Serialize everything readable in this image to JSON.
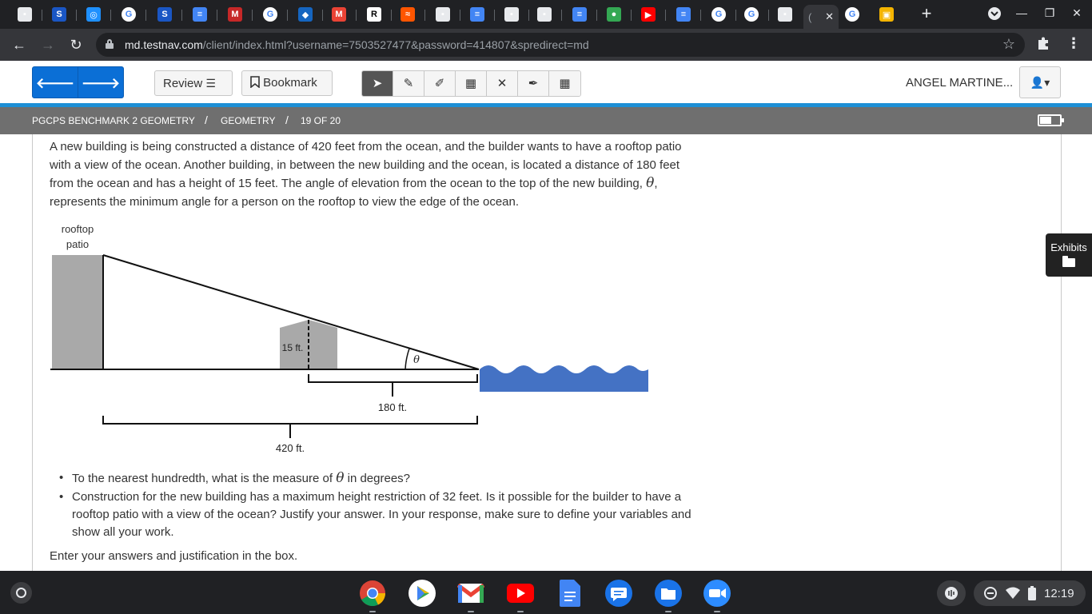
{
  "browser": {
    "url_host": "md.testnav.com",
    "url_path": "/client/index.html?username=7503527477&password=414807&spredirect=md",
    "tabs": [
      {
        "icon": "classroom-icon",
        "color": "#e8eaed",
        "glyph": "▪"
      },
      {
        "icon": "studyisland-icon",
        "color": "#1a56c4",
        "glyph": "S"
      },
      {
        "icon": "edpuzzle-icon",
        "color": "#1e90ff",
        "glyph": "◎"
      },
      {
        "icon": "google-icon",
        "color": "#ffffff",
        "glyph": "G"
      },
      {
        "icon": "studyisland-icon",
        "color": "#1a56c4",
        "glyph": "S"
      },
      {
        "icon": "google-docs-icon",
        "color": "#4285f4",
        "glyph": "≡"
      },
      {
        "icon": "mcgraw-hill-icon",
        "color": "#c62828",
        "glyph": "M"
      },
      {
        "icon": "google-icon",
        "color": "#ffffff",
        "glyph": "G"
      },
      {
        "icon": "clever-icon",
        "color": "#1565c0",
        "glyph": "◆"
      },
      {
        "icon": "gmail-icon",
        "color": "#ea4335",
        "glyph": "M"
      },
      {
        "icon": "readworks-icon",
        "color": "#ffffff",
        "glyph": "R"
      },
      {
        "icon": "soundcloud-icon",
        "color": "#ff5500",
        "glyph": "≈"
      },
      {
        "icon": "classroom-icon",
        "color": "#e8eaed",
        "glyph": "▪"
      },
      {
        "icon": "google-docs-icon",
        "color": "#4285f4",
        "glyph": "≡"
      },
      {
        "icon": "classroom-icon",
        "color": "#e8eaed",
        "glyph": "▪"
      },
      {
        "icon": "classroom-icon",
        "color": "#e8eaed",
        "glyph": "▪"
      },
      {
        "icon": "google-docs-icon",
        "color": "#4285f4",
        "glyph": "≡"
      },
      {
        "icon": "google-maps-icon",
        "color": "#34a853",
        "glyph": "●"
      },
      {
        "icon": "youtube-icon",
        "color": "#ff0000",
        "glyph": "▶"
      },
      {
        "icon": "google-docs-icon",
        "color": "#4285f4",
        "glyph": "≡"
      },
      {
        "icon": "google-icon",
        "color": "#ffffff",
        "glyph": "G"
      },
      {
        "icon": "google-icon",
        "color": "#ffffff",
        "glyph": "G"
      },
      {
        "icon": "classroom-icon",
        "color": "#e8eaed",
        "glyph": "▪"
      }
    ],
    "active_tab_glyph": "(",
    "after_tabs": [
      {
        "icon": "google-icon",
        "color": "#ffffff",
        "glyph": "G"
      },
      {
        "icon": "google-slides-icon",
        "color": "#f4b400",
        "glyph": "▣"
      }
    ]
  },
  "testnav": {
    "review_label": "Review",
    "bookmark_label": "Bookmark",
    "user_name": "ANGEL MARTINE...",
    "breadcrumb": {
      "test": "PGCPS BENCHMARK 2 GEOMETRY",
      "sep": "/",
      "section": "GEOMETRY",
      "position": "19 OF 20"
    },
    "exhibits_label": "Exhibits"
  },
  "question": {
    "p1": "A new building is being constructed a distance of 420 feet from the ocean, and the builder wants to have a rooftop patio with a view of the ocean.  Another building, in between the new building and the ocean, is located a distance of 180 feet from the ocean and has a height of 15 feet.  The angle of elevation from the ocean to the top of the new building, ",
    "theta": "θ",
    "p1_end": ", represents the minimum angle for a person on the rooftop to view the edge of the ocean.",
    "bullet1_a": "To the nearest hundredth, what is the measure of ",
    "bullet1_b": " in degrees?",
    "bullet2": "Construction for the new building has a maximum height restriction of 32 feet.  Is it possible for the builder to have a rooftop patio with a view of the ocean?  Justify your answer.  In your response, make sure to define your variables and show all your work.",
    "enter": "Enter your answers and justification in the box."
  },
  "diagram": {
    "rooftop_line1": "rooftop",
    "rooftop_line2": "patio",
    "height_label": "15 ft.",
    "angle_label": "θ",
    "dist1_label": "180 ft.",
    "dist2_label": "420 ft.",
    "building_color": "#a9a9a9",
    "ocean_color": "#4472c4"
  },
  "shelf": {
    "time": "12:19"
  }
}
